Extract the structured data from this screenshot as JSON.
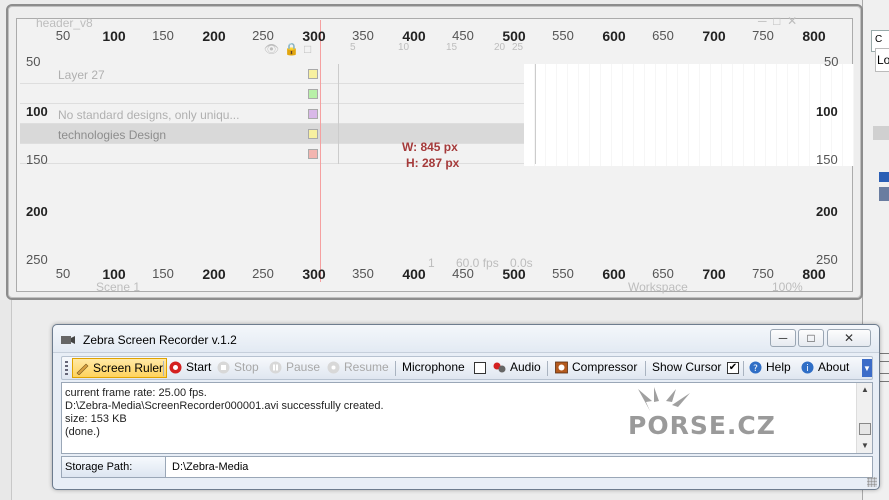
{
  "background_app": {
    "file_tab": "header_v8",
    "right_panel_label": "Lo",
    "timeline": {
      "layers": [
        {
          "name": "Layer 27",
          "color": "#f7f0a0"
        },
        {
          "name": "",
          "color": "#b8f0a8"
        },
        {
          "name": "No standard designs, only uniqu...",
          "color": "#d9b8e8"
        },
        {
          "name": "technologies  Design",
          "color": "#f7f0a0"
        },
        {
          "name": "",
          "color": "#f3b5b0"
        }
      ],
      "frame_numbers": [
        "1",
        "5",
        "10",
        "15",
        "20",
        "25"
      ],
      "status": {
        "frame": "1",
        "fps": "60.0 fps",
        "time": "0.0s"
      },
      "scene": "Scene 1",
      "workspace": "Workspace",
      "zoom": "100%"
    }
  },
  "screen_ruler": {
    "horizontal_labels": [
      {
        "text": "50",
        "major": false
      },
      {
        "text": "100",
        "major": true
      },
      {
        "text": "150",
        "major": false
      },
      {
        "text": "200",
        "major": true
      },
      {
        "text": "250",
        "major": false
      },
      {
        "text": "300",
        "major": true
      },
      {
        "text": "350",
        "major": false
      },
      {
        "text": "400",
        "major": true
      },
      {
        "text": "450",
        "major": false
      },
      {
        "text": "500",
        "major": true
      },
      {
        "text": "550",
        "major": false
      },
      {
        "text": "600",
        "major": true
      },
      {
        "text": "650",
        "major": false
      },
      {
        "text": "700",
        "major": true
      },
      {
        "text": "750",
        "major": false
      },
      {
        "text": "800",
        "major": true
      }
    ],
    "vertical_labels": [
      {
        "text": "50",
        "major": false
      },
      {
        "text": "100",
        "major": true
      },
      {
        "text": "150",
        "major": false
      },
      {
        "text": "200",
        "major": true
      },
      {
        "text": "250",
        "major": false
      }
    ],
    "width_readout": "W: 845 px",
    "height_readout": "H: 287 px"
  },
  "recorder": {
    "title": "Zebra Screen Recorder v.1.2",
    "window_buttons": {
      "minimize": "─",
      "maximize": "□",
      "close": "✕"
    },
    "toolbar": {
      "screen_ruler": "Screen Ruler",
      "start": "Start",
      "stop": "Stop",
      "pause": "Pause",
      "resume": "Resume",
      "microphone": "Microphone",
      "microphone_checked": false,
      "audio": "Audio",
      "compressor": "Compressor",
      "show_cursor": "Show Cursor",
      "show_cursor_checked": true,
      "help": "Help",
      "about": "About"
    },
    "log_lines": [
      "current frame rate: 25.00 fps.",
      "D:\\Zebra-Media\\ScreenRecorder000001.avi successfully created.",
      "size: 153 KB",
      "(done.)"
    ],
    "watermark": "PORSE.CZ",
    "storage_label": "Storage Path:",
    "storage_value": "D:\\Zebra-Media"
  },
  "colors": {
    "accent_highlight": "#ffd35d",
    "measure_text": "#a53a3a",
    "record_red": "#d42020"
  }
}
